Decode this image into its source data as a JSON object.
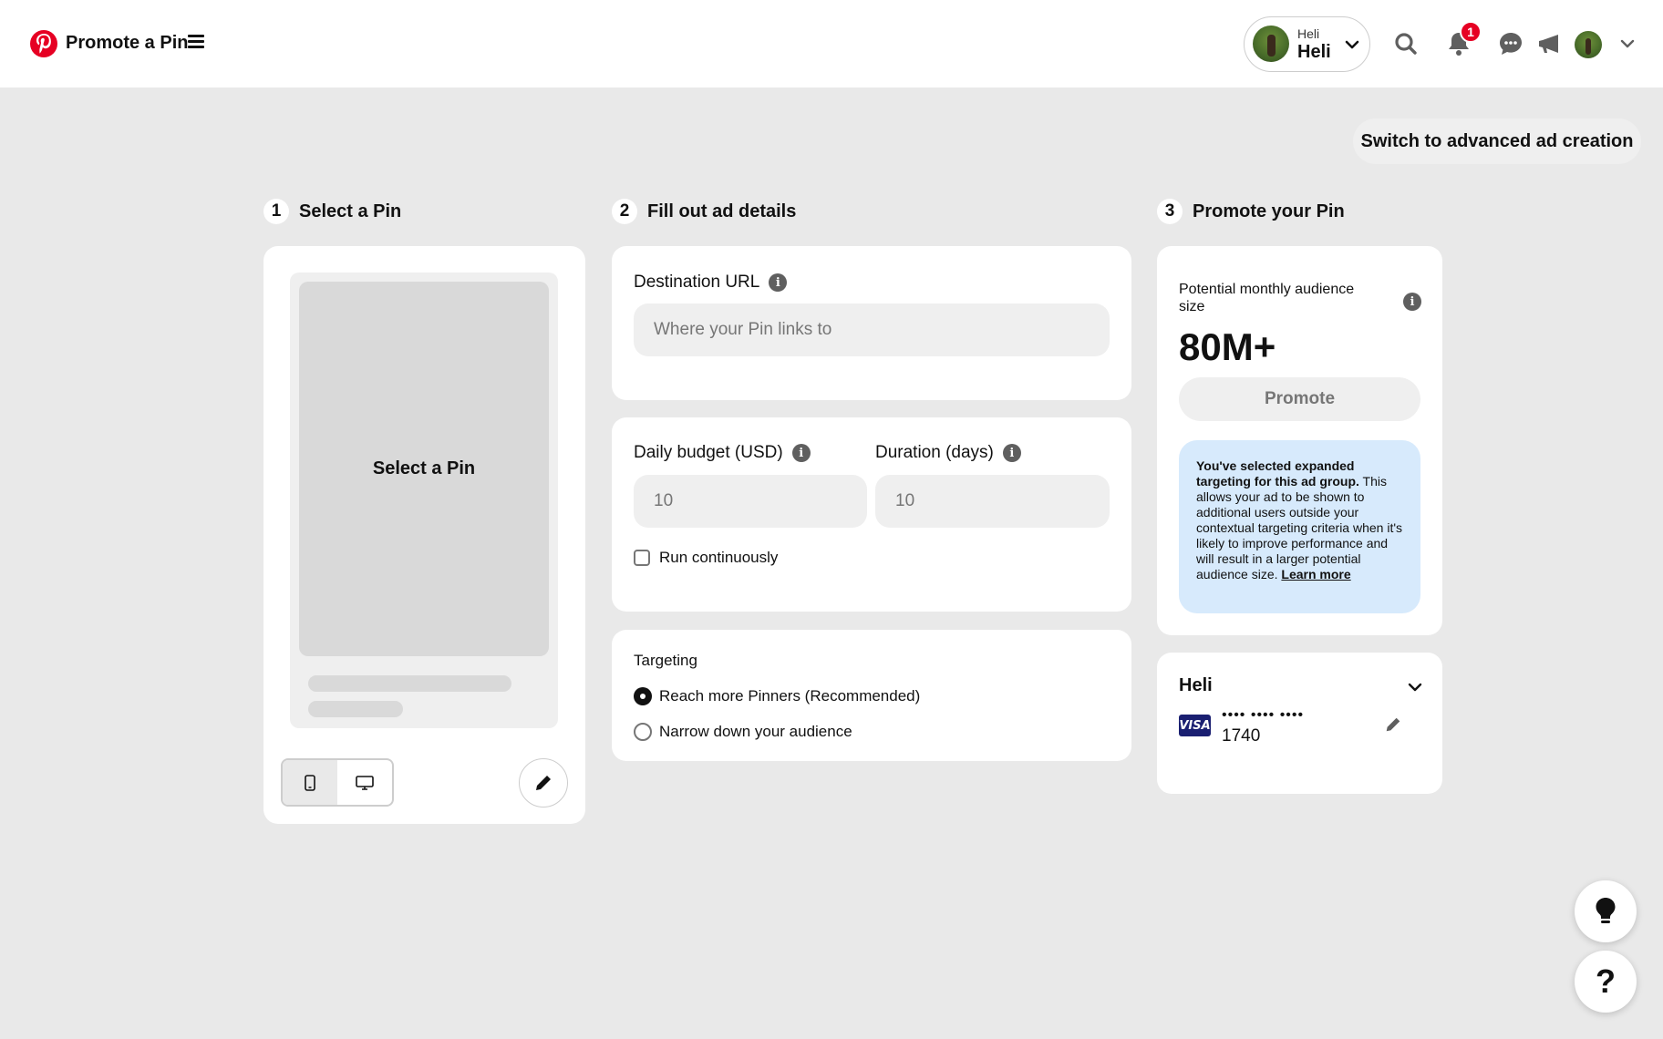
{
  "header": {
    "app_title": "Promote a Pin",
    "account_small": "Heli",
    "account_big": "Heli",
    "notification_count": "1"
  },
  "advanced_button": "Switch to advanced ad creation",
  "steps": [
    {
      "number": "1",
      "title": "Select a Pin"
    },
    {
      "number": "2",
      "title": "Fill out ad details"
    },
    {
      "number": "3",
      "title": "Promote your Pin"
    }
  ],
  "pin": {
    "placeholder": "Select a Pin"
  },
  "destination": {
    "label": "Destination URL",
    "placeholder": "Where your Pin links to"
  },
  "budget": {
    "daily_label": "Daily budget (USD)",
    "daily_placeholder": "10",
    "duration_label": "Duration (days)",
    "duration_placeholder": "10",
    "run_continuously": "Run continuously"
  },
  "targeting": {
    "title": "Targeting",
    "options": [
      {
        "label": "Reach more Pinners (Recommended)",
        "selected": true
      },
      {
        "label": "Narrow down your audience",
        "selected": false
      }
    ]
  },
  "promote": {
    "audience_label": "Potential monthly audience size",
    "audience_value": "80M+",
    "button": "Promote",
    "notice_bold": "You've selected expanded targeting for this ad group.",
    "notice_text": " This allows your ad to be shown to additional users outside your contextual targeting criteria when it's likely to improve performance and will result in a larger potential audience size.",
    "learn_more": "Learn more"
  },
  "payment": {
    "account_name": "Heli",
    "card_brand": "VISA",
    "card_mask": "•••• •••• ••••",
    "card_last4": "1740"
  },
  "colors": {
    "brand": "#e60023",
    "notice_bg": "#d7eafc",
    "page_bg": "#e9e9e9"
  }
}
